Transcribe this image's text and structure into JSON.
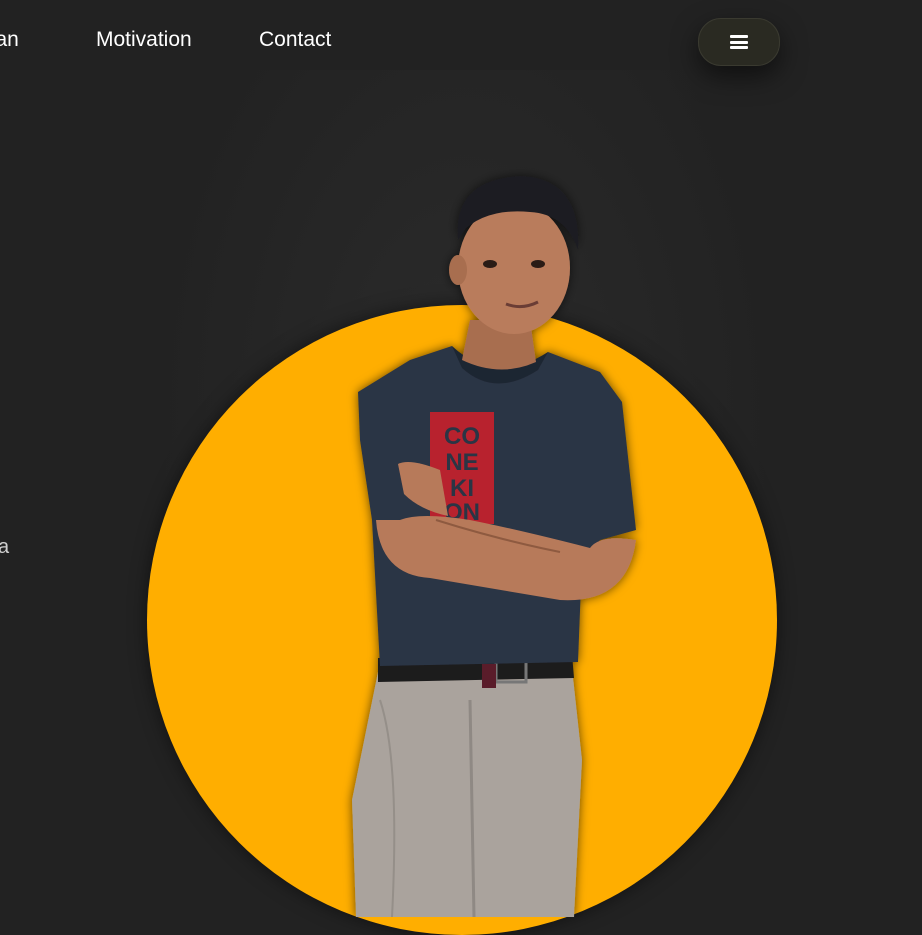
{
  "nav": {
    "links": [
      {
        "label": "man"
      },
      {
        "label": "Motivation"
      },
      {
        "label": "Contact"
      }
    ],
    "menu_icon": "hamburger-menu-icon"
  },
  "hero": {
    "side_text": "a",
    "circle_color": "#ffae00",
    "background_color": "#222222"
  }
}
